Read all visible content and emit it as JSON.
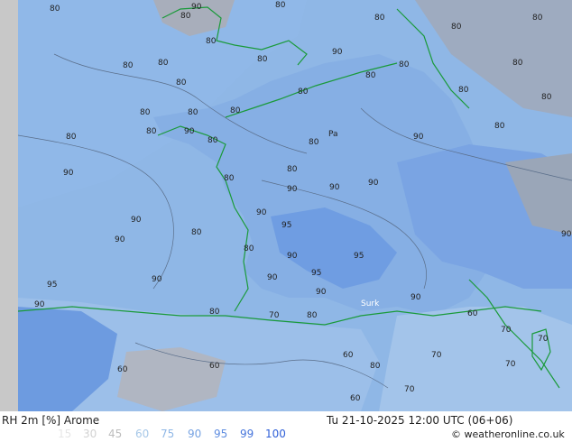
{
  "title": "RH 2m [%] Arome",
  "valid_time": "Tu 21-10-2025 12:00 UTC (06+06)",
  "credit": "© weatheronline.co.uk",
  "legend": [
    {
      "value": "15",
      "color": "#e6e6e6"
    },
    {
      "value": "30",
      "color": "#d2d2d2"
    },
    {
      "value": "45",
      "color": "#bdbdbd"
    },
    {
      "value": "60",
      "color": "#a7c8e8"
    },
    {
      "value": "75",
      "color": "#8fb7e6"
    },
    {
      "value": "90",
      "color": "#77a3e2"
    },
    {
      "value": "95",
      "color": "#5f8de0"
    },
    {
      "value": "99",
      "color": "#4776dc"
    },
    {
      "value": "100",
      "color": "#3060d8"
    }
  ],
  "map_labels": {
    "paris": "Pa",
    "site": "Surk"
  },
  "contour_values": [
    "60",
    "70",
    "80",
    "90",
    "95"
  ]
}
